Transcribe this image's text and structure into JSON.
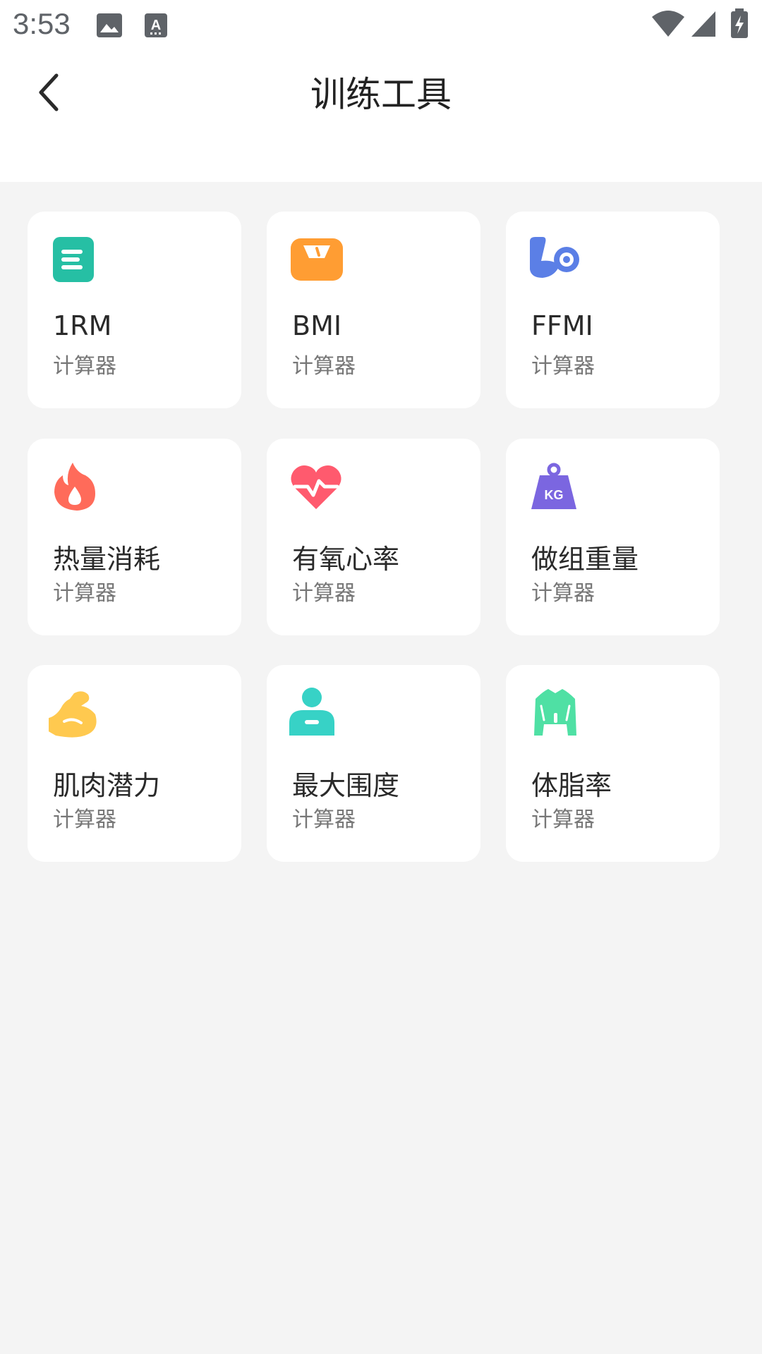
{
  "status_bar": {
    "time": "3:53",
    "left_icons": [
      "image-icon",
      "text-icon"
    ],
    "right_icons": [
      "wifi-icon",
      "signal-icon",
      "battery-charging-icon"
    ]
  },
  "header": {
    "title": "训练工具",
    "back_icon": "chevron-left-icon"
  },
  "tools": [
    {
      "title": "1RM",
      "subtitle": "计算器",
      "icon": "document-icon",
      "color": "#26bfa4"
    },
    {
      "title": "BMI",
      "subtitle": "计算器",
      "icon": "scale-icon",
      "color": "#ff9d33"
    },
    {
      "title": "FFMI",
      "subtitle": "计算器",
      "icon": "arm-scale-icon",
      "color": "#5b7fe6"
    },
    {
      "title": "热量消耗",
      "subtitle": "计算器",
      "icon": "flame-icon",
      "color": "#ff6b5a"
    },
    {
      "title": "有氧心率",
      "subtitle": "计算器",
      "icon": "heart-rate-icon",
      "color": "#ff5a6e"
    },
    {
      "title": "做组重量",
      "subtitle": "计算器",
      "icon": "kg-weight-icon",
      "color": "#7b66e0"
    },
    {
      "title": "肌肉潜力",
      "subtitle": "计算器",
      "icon": "muscle-arm-icon",
      "color": "#ffc94f"
    },
    {
      "title": "最大围度",
      "subtitle": "计算器",
      "icon": "body-measure-icon",
      "color": "#37d2c6"
    },
    {
      "title": "体脂率",
      "subtitle": "计算器",
      "icon": "torso-icon",
      "color": "#4fe0a4"
    }
  ],
  "kg_label": "KG"
}
